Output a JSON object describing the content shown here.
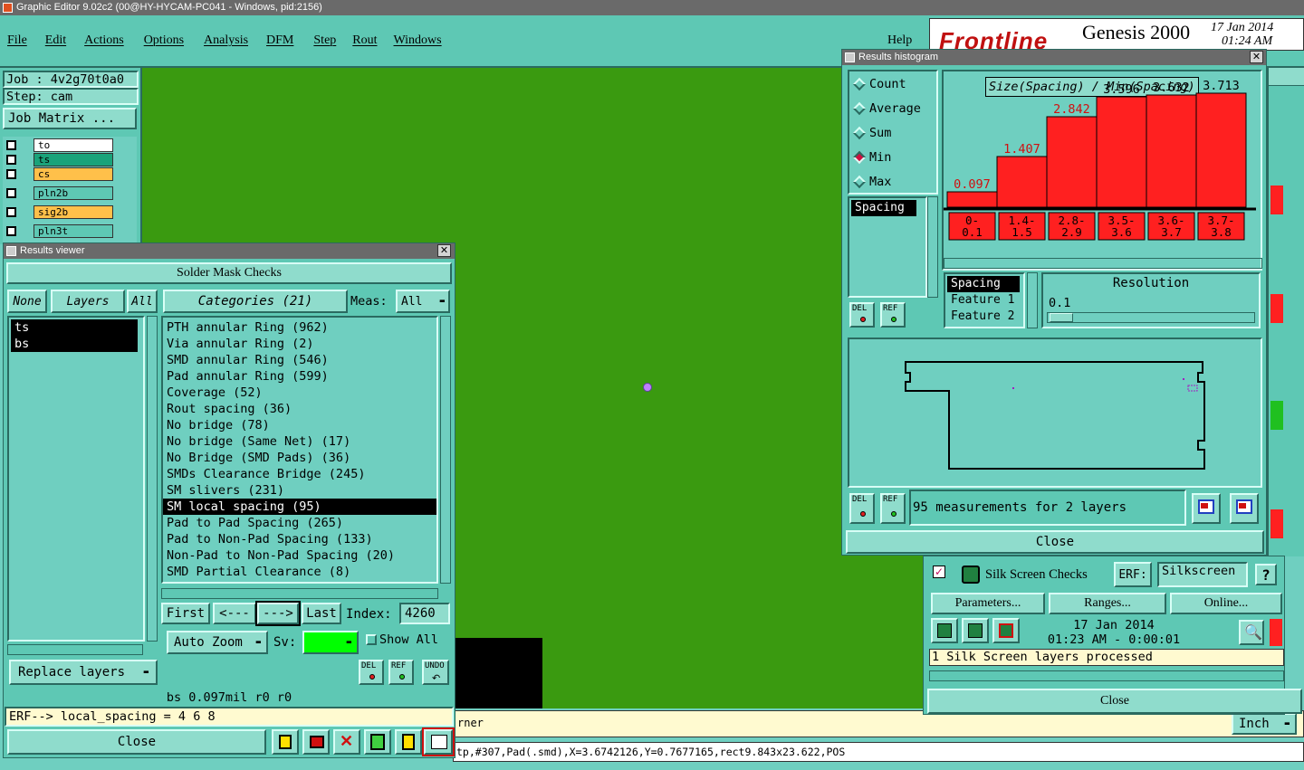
{
  "titlebar": {
    "text": "Graphic Editor 9.02c2 (00@HY-HYCAM-PC041 - Windows, pid:2156)"
  },
  "menu": [
    "File",
    "Edit",
    "Actions",
    "Options",
    "Analysis",
    "DFM",
    "Step",
    "Rout",
    "Windows"
  ],
  "help_label": "Help",
  "brand": {
    "logo": "Frontline",
    "product": "Genesis 2000",
    "date": "17 Jan 2014",
    "time": "01:24 AM"
  },
  "job": {
    "job_line": "Job : 4v2g70t0a0",
    "step_line": "Step: cam",
    "matrix_button": "Job Matrix ..."
  },
  "layers": [
    {
      "name": "to",
      "color": "#ffffff"
    },
    {
      "name": "ts",
      "color": "#1aa37a"
    },
    {
      "name": "cs",
      "color": "#ffc04a"
    },
    {
      "name": "pln2b",
      "color": "#5ec8b4"
    },
    {
      "name": "sig2b",
      "color": "#ffc04a"
    },
    {
      "name": "pln3t",
      "color": "#5ec8b4"
    }
  ],
  "results_viewer": {
    "title": "Results viewer",
    "header": "Solder Mask Checks",
    "none_btn": "None",
    "layers_btn": "Layers",
    "all_btn": "All",
    "categories_btn": "Categories (21)",
    "meas_label": "Meas:",
    "meas_value": "All",
    "layer_list": [
      "ts",
      "bs"
    ],
    "categories": [
      "PTH annular Ring (962)",
      "Via annular Ring (2)",
      "SMD annular Ring (546)",
      "Pad annular Ring (599)",
      "Coverage (52)",
      "Rout spacing (36)",
      "No bridge (78)",
      "No bridge (Same Net) (17)",
      "No Bridge (SMD Pads) (36)",
      "SMDs Clearance Bridge (245)",
      "SM slivers (231)",
      "SM local spacing (95)",
      "Pad to Pad Spacing (265)",
      "Pad to Non-Pad Spacing (133)",
      "Non-Pad to Non-Pad Spacing (20)",
      "SMD Partial Clearance (8)"
    ],
    "selected_category": 11,
    "first_btn": "First",
    "prev_btn": "<---",
    "next_btn": "--->",
    "last_btn": "Last",
    "index_label": "Index:",
    "index_value": "4260",
    "auto_zoom": "Auto Zoom",
    "sv_label": "Sv:",
    "show_all": "Show All",
    "replace_layers": "Replace layers",
    "status": "bs 0.097mil   r0   r0",
    "erf": "ERF--> local_spacing = 4 6 8",
    "close": "Close",
    "del": "DEL",
    "ref": "REF",
    "undo": "UNDO"
  },
  "histogram": {
    "title": "Results histogram",
    "modes": [
      "Count",
      "Average",
      "Sum",
      "Min",
      "Max"
    ],
    "selected_mode": "Min",
    "measure_list": [
      "Spacing"
    ],
    "chart_title": "Size(Spacing) / Min(Spacing)",
    "spacing_list": [
      "Spacing",
      "Feature 1",
      "Feature 2"
    ],
    "resolution_label": "Resolution",
    "resolution_value": "0.1",
    "measurements": "95 measurements for 2 layers",
    "close": "Close",
    "del": "DEL",
    "ref": "REF"
  },
  "chart_data": {
    "type": "bar",
    "title": "Size(Spacing) / Min(Spacing)",
    "categories": [
      "0-0.1",
      "1.4-1.5",
      "2.8-2.9",
      "3.5-3.6",
      "3.6-3.7",
      "3.7-3.8"
    ],
    "category_top": [
      "0-",
      "1.4-",
      "2.8-",
      "3.5-",
      "3.6-",
      "3.7-"
    ],
    "category_bottom": [
      "0.1",
      "1.5",
      "2.9",
      "3.6",
      "3.7",
      "3.8"
    ],
    "values": [
      0.097,
      1.407,
      2.842,
      3.596,
      3.632,
      3.713
    ],
    "value_labels": [
      "0.097",
      "1.407",
      "2.842",
      "3.596",
      "3.632",
      "3.713"
    ],
    "label_colors": [
      "#d01010",
      "#d01010",
      "#d01010",
      "#000000",
      "#000000",
      "#000000"
    ],
    "bar_color": "#ff2020",
    "ylim": [
      0,
      3.713
    ]
  },
  "silk": {
    "title": "Silk Screen Checks",
    "erf_label": "ERF:",
    "erf_value": "Silkscreen",
    "help": "?",
    "parameters": "Parameters...",
    "ranges": "Ranges...",
    "online": "Online...",
    "date": "17 Jan 2014",
    "time": "01:23 AM - 0:00:01",
    "status": "1 Silk Screen layers processed",
    "close": "Close"
  },
  "bottom": {
    "corner_text": "rner",
    "units": "Inch",
    "status_line": "tp,#307,Pad(.smd),X=3.6742126,Y=0.7677165,rect9.843x23.622,POS"
  },
  "colors": {
    "canvas": "#3a9a10",
    "teal": "#5ec8b4",
    "panel": "#8fdccc",
    "bar": "#ff2020"
  }
}
